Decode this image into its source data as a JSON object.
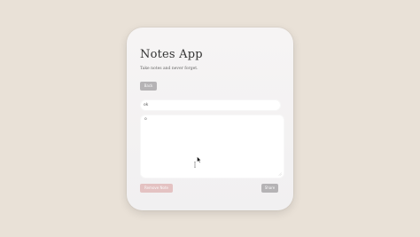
{
  "app": {
    "title": "Notes App",
    "subtitle": "Take notes and never forget."
  },
  "toolbar": {
    "back_label": "Back"
  },
  "note": {
    "title_value": "ok",
    "body_value": "o"
  },
  "actions": {
    "remove_label": "Remove Note",
    "share_label": "Share"
  },
  "colors": {
    "background": "#e9e1d7",
    "card": "#f4f3f3",
    "neutral_button": "#b5b3b5",
    "danger_button": "#e4c2c2"
  },
  "icons": {
    "cursor": "mouse-pointer-icon",
    "text_cursor": "i-beam-icon"
  }
}
